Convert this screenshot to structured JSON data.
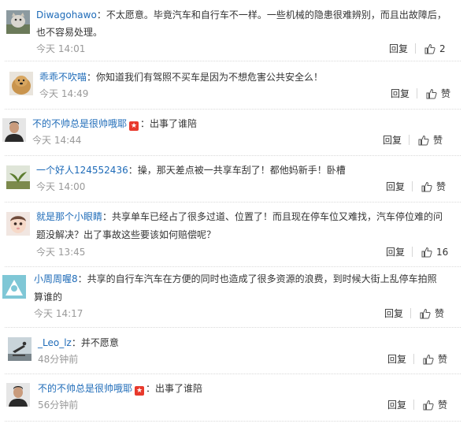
{
  "comments": [
    {
      "user": "Diwagohawo",
      "vip": false,
      "lines": [
        "不太愿意。毕竟汽车和自行车不一样。一些机械的隐患很难辨别，而且出故障后，",
        "也不容易处理。"
      ],
      "time": "今天 14:01",
      "reply": "回复",
      "likes": "2",
      "avatar": "cat-photo"
    },
    {
      "user": "乖乖不吹喵",
      "vip": false,
      "lines": [
        "你知道我们有驾照不买车是因为不想危害公共安全么！"
      ],
      "time": "今天 14:49",
      "reply": "回复",
      "likes": "赞",
      "avatar": "dog-photo"
    },
    {
      "user": "不的不帅总是很帅哦耶",
      "vip": true,
      "lines": [
        "出事了谁陪"
      ],
      "time": "今天 14:44",
      "reply": "回复",
      "likes": "赞",
      "avatar": "man-portrait"
    },
    {
      "user": "一个好人124552436",
      "vip": false,
      "lines": [
        "操，那天差点被一共享车刮了！都他妈新手！卧槽"
      ],
      "time": "今天 14:00",
      "reply": "回复",
      "likes": "赞",
      "avatar": "plant-photo"
    },
    {
      "user": "就是那个小眼睛",
      "vip": false,
      "lines": [
        "共享单车已经占了很多过道、位置了！而且现在停车位又难找，汽车停位难的问",
        "题没解决？出了事故这些要该如何赔偿呢？"
      ],
      "time": "今天 13:45",
      "reply": "回复",
      "likes": "16",
      "avatar": "baby-photo"
    },
    {
      "user": "小周周喔8",
      "vip": false,
      "lines": [
        "共享的自行车汽车在方便的同时也造成了很多资源的浪费，到时候大街上乱停车拍照",
        "算谁的"
      ],
      "time": "今天 14:17",
      "reply": "回复",
      "likes": "赞",
      "avatar": "cartoon-avatar"
    },
    {
      "user": "_Leo_lz",
      "vip": false,
      "lines": [
        "并不愿意"
      ],
      "time": "48分钟前",
      "reply": "回复",
      "likes": "赞",
      "avatar": "skater-photo"
    },
    {
      "user": "不的不帅总是很帅哦耶",
      "vip": true,
      "lines": [
        "出事了谁陪"
      ],
      "time": "56分钟前",
      "reply": "回复",
      "likes": "赞",
      "avatar": "man-portrait"
    }
  ]
}
